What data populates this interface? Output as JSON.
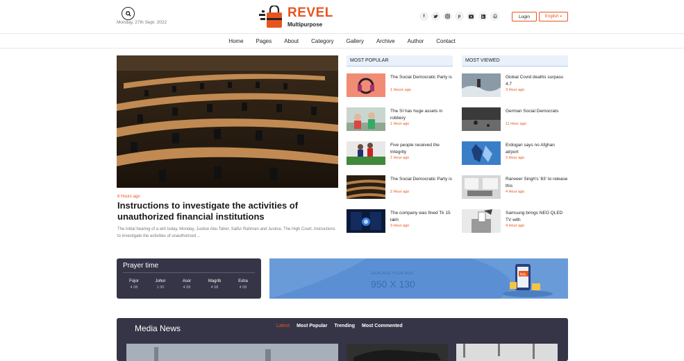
{
  "header": {
    "date": "Monday, 27th Sept. 2022",
    "logo_title": "REVEL",
    "logo_sub": "Multipurpose",
    "social_icons": [
      "facebook-icon",
      "twitter-icon",
      "instagram-icon",
      "pinterest-icon",
      "youtube-icon",
      "linkedin-icon",
      "notification-icon"
    ],
    "login_label": "Login",
    "language_label": "English",
    "accent_color": "#e8541e"
  },
  "nav": {
    "items": [
      "Home",
      "Pages",
      "About",
      "Category",
      "Gallery",
      "Archive",
      "Author",
      "Contact"
    ]
  },
  "hero": {
    "time": "6 Hours ago",
    "title": "Instructions to investigate the activities of unauthorized financial institutions",
    "description": "The initial hearing of a writ today, Monday, Justice Abu Taher, Saifur Rahman and Justice, The High Court, Instructions to investigate the activities of unauthorized ..."
  },
  "most_popular": {
    "heading": "MOST POPULAR",
    "items": [
      {
        "title": "The Social Democratic Party is",
        "time": "1 Hours ago"
      },
      {
        "title": "The SI has huge assets in robbery",
        "time": "1 Hour ago"
      },
      {
        "title": "Five people received the Integrity",
        "time": "1 Hour ago"
      },
      {
        "title": "The Social Democratic Party is",
        "time": "2 Hour ago"
      },
      {
        "title": "The company was fined Tk 15 lakh",
        "time": "3 Hour ago"
      }
    ]
  },
  "most_viewed": {
    "heading": "MOST VIEWED",
    "items": [
      {
        "title": "Global Covid deaths surpass 4.7",
        "time": "3 Hour ago"
      },
      {
        "title": "German Social Democrats",
        "time": "11 Hour ago"
      },
      {
        "title": "Erdogan says no Afghan airport",
        "time": "3 Hour ago"
      },
      {
        "title": "Ranveer Singh's '83' to release this",
        "time": "4 Hour ago"
      },
      {
        "title": "Samsung brings NEO QLED TV with",
        "time": "4 Hour ago"
      }
    ]
  },
  "prayer": {
    "title": "Prayer time",
    "times": [
      {
        "name": "Fojor",
        "time": "4 08"
      },
      {
        "name": "Johor",
        "time": "1 00"
      },
      {
        "name": "Asor",
        "time": "4 08"
      },
      {
        "name": "Magrib",
        "time": "4 08"
      },
      {
        "name": "Esha",
        "time": "4 08"
      }
    ]
  },
  "ad": {
    "small": "REPLACE YOUR ADS",
    "big": "950 X 130",
    "badge": "Ads."
  },
  "media": {
    "title": "Media News",
    "tabs": [
      "Latest",
      "Most Popular",
      "Trending",
      "Most Commented"
    ]
  }
}
